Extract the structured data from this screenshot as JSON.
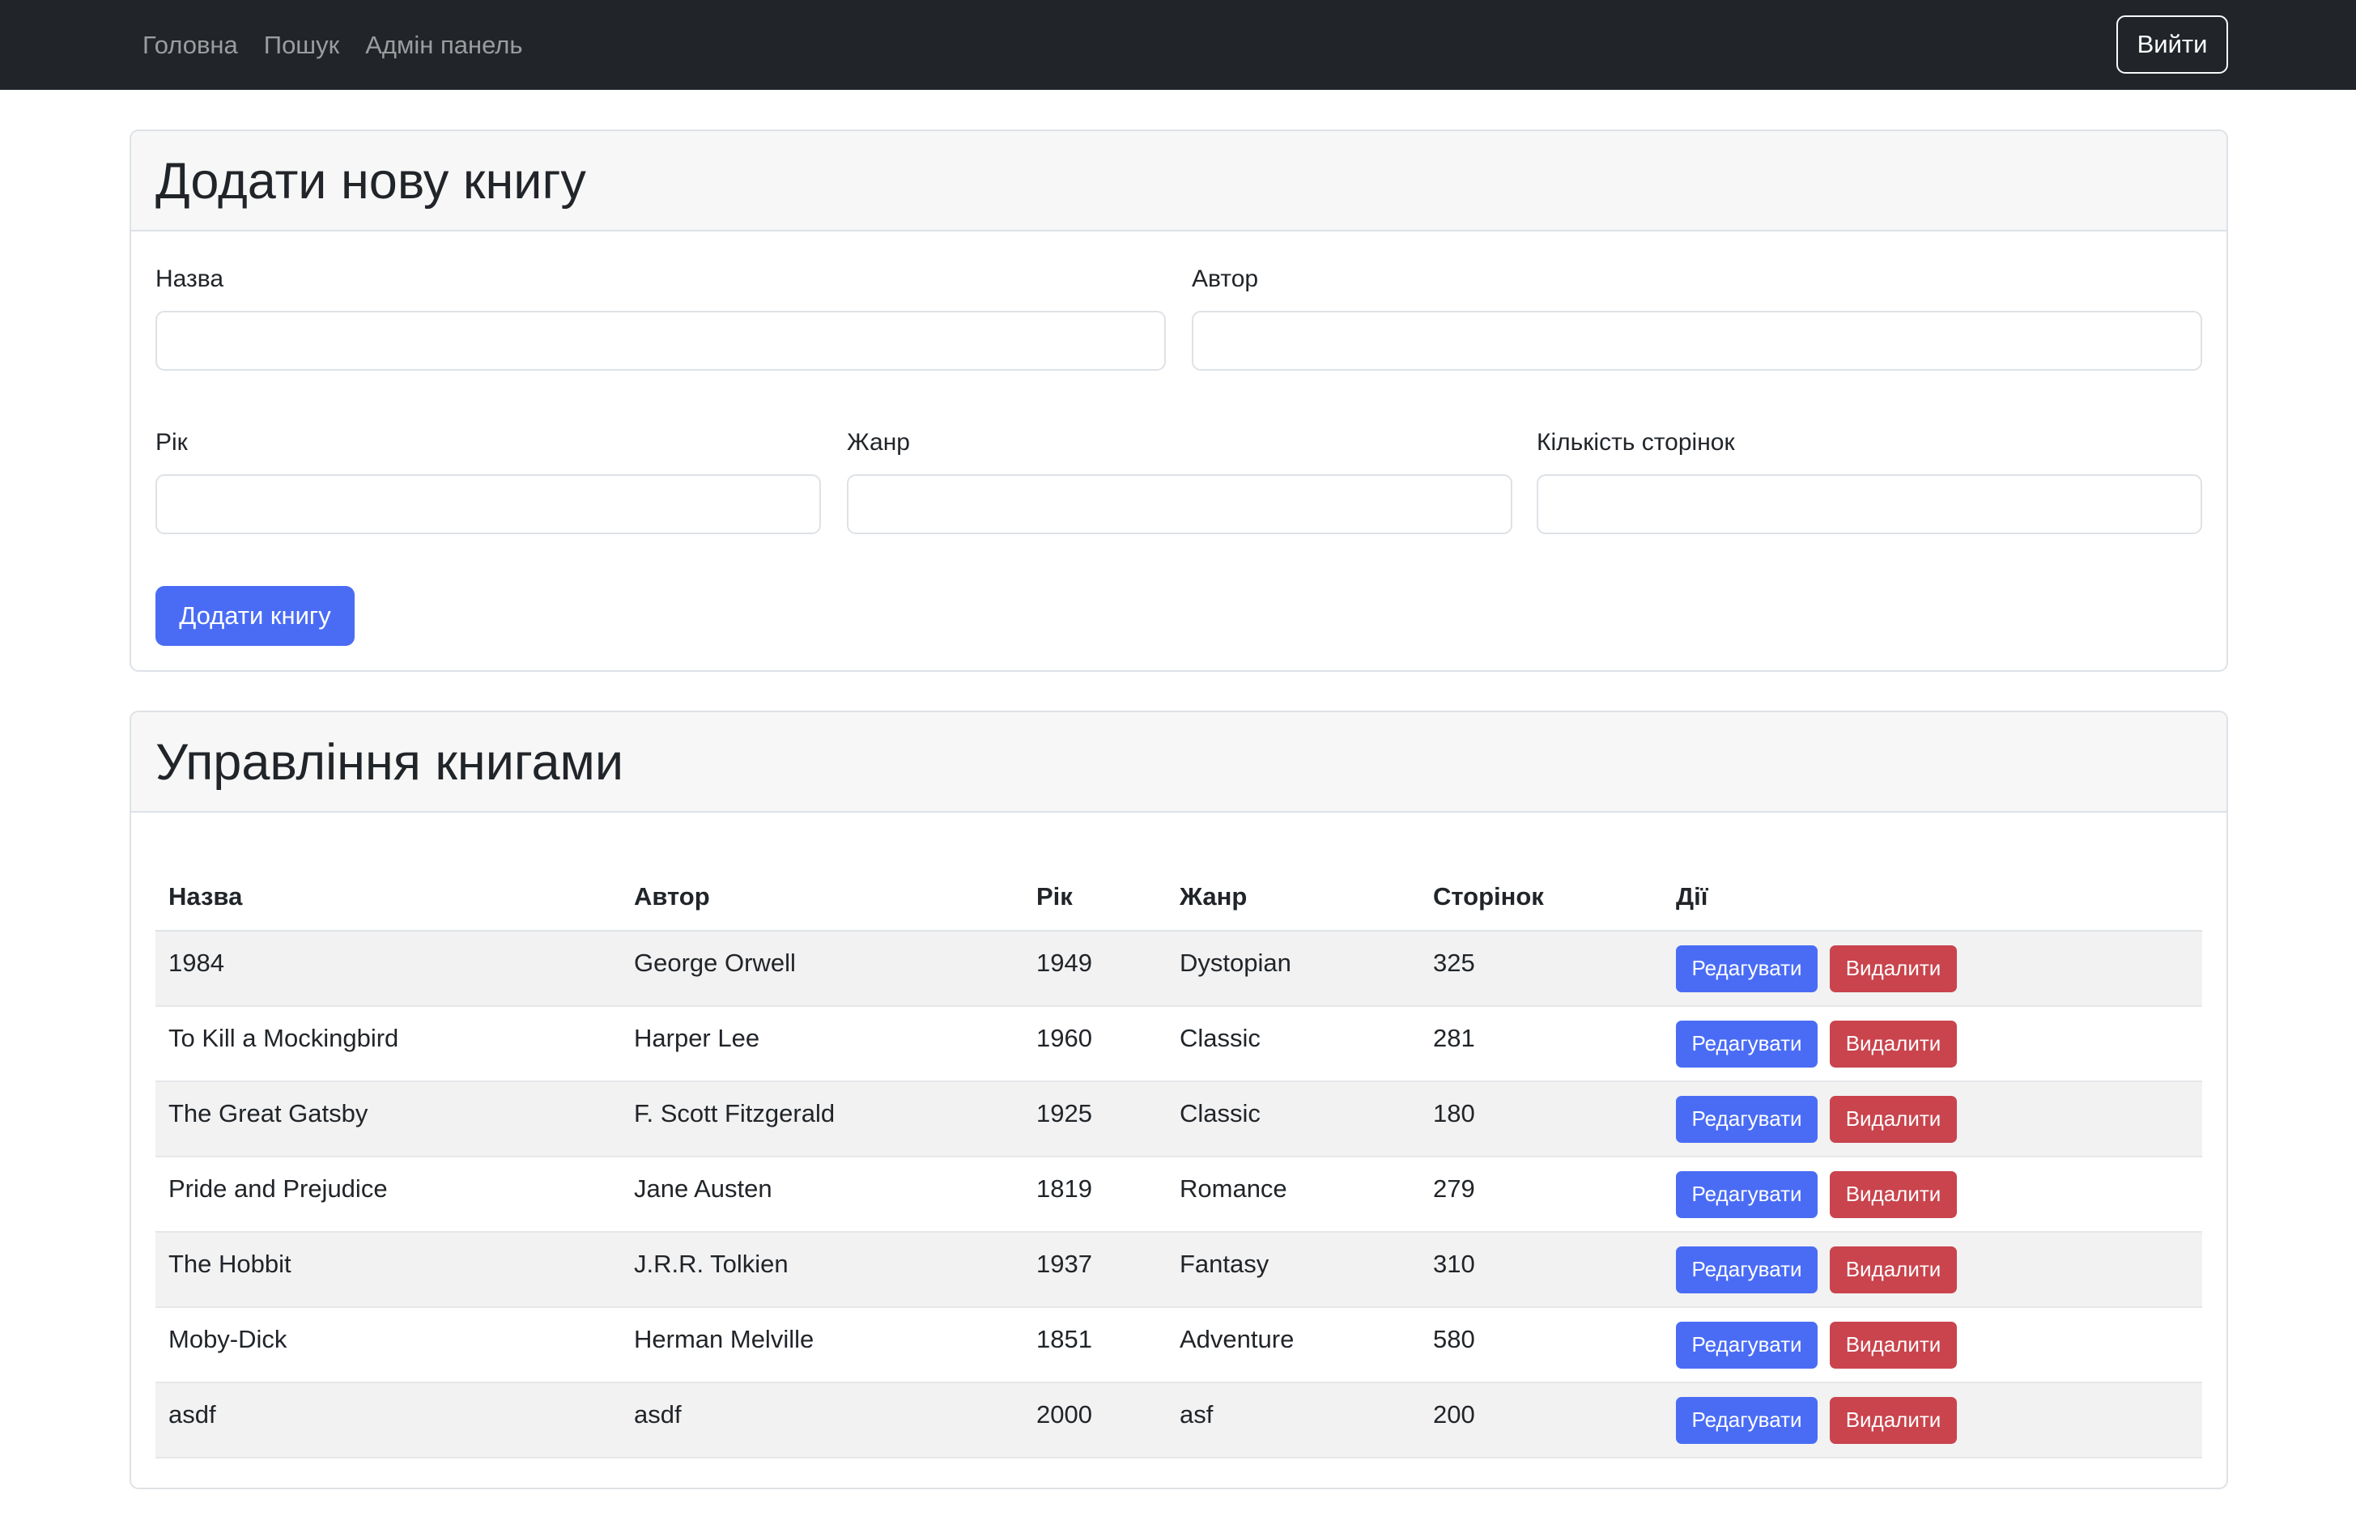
{
  "nav": {
    "links": [
      "Головна",
      "Пошук",
      "Адмін панель"
    ],
    "logout_label": "Вийти"
  },
  "add_form": {
    "title": "Додати нову книгу",
    "labels": {
      "title": "Назва",
      "author": "Автор",
      "year": "Рік",
      "genre": "Жанр",
      "pages": "Кількість сторінок"
    },
    "values": {
      "title": "",
      "author": "",
      "year": "",
      "genre": "",
      "pages": ""
    },
    "submit_label": "Додати книгу"
  },
  "manage": {
    "title": "Управління книгами",
    "columns": [
      "Назва",
      "Автор",
      "Рік",
      "Жанр",
      "Сторінок",
      "Дії"
    ],
    "edit_label": "Редагувати",
    "delete_label": "Видалити",
    "rows": [
      [
        "1984",
        "George Orwell",
        "1949",
        "Dystopian",
        "325"
      ],
      [
        "To Kill a Mockingbird",
        "Harper Lee",
        "1960",
        "Classic",
        "281"
      ],
      [
        "The Great Gatsby",
        "F. Scott Fitzgerald",
        "1925",
        "Classic",
        "180"
      ],
      [
        "Pride and Prejudice",
        "Jane Austen",
        "1819",
        "Romance",
        "279"
      ],
      [
        "The Hobbit",
        "J.R.R. Tolkien",
        "1937",
        "Fantasy",
        "310"
      ],
      [
        "Moby-Dick",
        "Herman Melville",
        "1851",
        "Adventure",
        "580"
      ],
      [
        "asdf",
        "asdf",
        "2000",
        "asf",
        "200"
      ]
    ]
  },
  "colors": {
    "navbar_bg": "#212529",
    "primary": "#4a6cf5",
    "danger": "#c9444d"
  }
}
